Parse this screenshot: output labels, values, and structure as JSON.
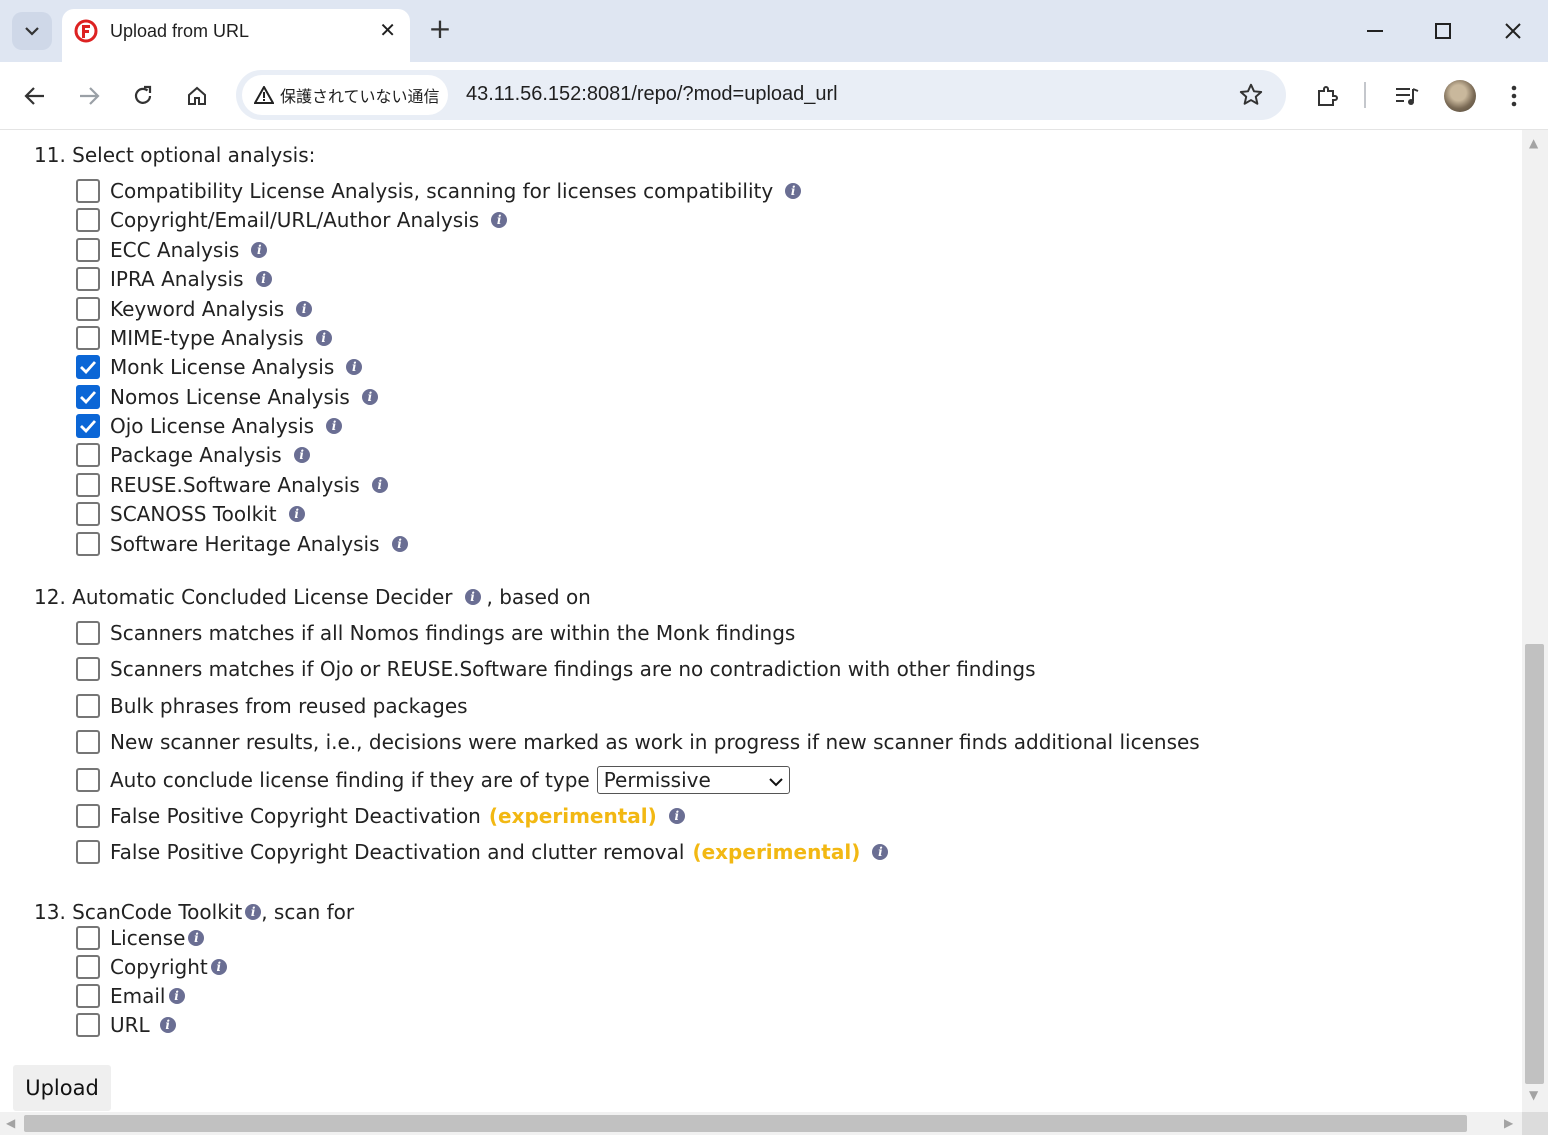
{
  "browser": {
    "tab_title": "Upload from URL",
    "security_label": "保護されていない通信",
    "url": "43.11.56.152:8081/repo/?mod=upload_url"
  },
  "section11": {
    "title": "11. Select optional analysis:",
    "options": [
      {
        "label": "Compatibility License Analysis, scanning for licenses compatibility",
        "checked": false
      },
      {
        "label": "Copyright/Email/URL/Author Analysis",
        "checked": false
      },
      {
        "label": "ECC Analysis",
        "checked": false
      },
      {
        "label": "IPRA Analysis",
        "checked": false
      },
      {
        "label": "Keyword Analysis",
        "checked": false
      },
      {
        "label": "MIME-type Analysis",
        "checked": false
      },
      {
        "label": "Monk License Analysis",
        "checked": true
      },
      {
        "label": "Nomos License Analysis",
        "checked": true
      },
      {
        "label": "Ojo License Analysis",
        "checked": true
      },
      {
        "label": "Package Analysis",
        "checked": false
      },
      {
        "label": "REUSE.Software Analysis",
        "checked": false
      },
      {
        "label": "SCANOSS Toolkit",
        "checked": false
      },
      {
        "label": "Software Heritage Analysis",
        "checked": false
      }
    ]
  },
  "section12": {
    "title": "12. Automatic Concluded License Decider",
    "title_suffix": ", based on",
    "options": [
      {
        "label": "Scanners matches if all Nomos findings are within the Monk findings",
        "checked": false
      },
      {
        "label": "Scanners matches if Ojo or REUSE.Software findings are no contradiction with other findings",
        "checked": false
      },
      {
        "label": "Bulk phrases from reused packages",
        "checked": false
      },
      {
        "label": "New scanner results, i.e., decisions were marked as work in progress if new scanner finds additional licenses",
        "checked": false
      },
      {
        "label": "Auto conclude license finding if they are of type",
        "checked": false,
        "select_value": "Permissive"
      },
      {
        "label": "False Positive Copyright Deactivation",
        "checked": false,
        "tag": "(experimental)"
      },
      {
        "label": "False Positive Copyright Deactivation and clutter removal",
        "checked": false,
        "tag": "(experimental)"
      }
    ]
  },
  "section13": {
    "title": "13. ScanCode Toolkit",
    "title_suffix": ", scan for",
    "options": [
      {
        "label": "License",
        "checked": false
      },
      {
        "label": "Copyright",
        "checked": false
      },
      {
        "label": "Email",
        "checked": false
      },
      {
        "label": "URL",
        "checked": false
      }
    ]
  },
  "upload_button": "Upload",
  "colors": {
    "checkbox_checked": "#0b66d6",
    "experimental": "#f2b813",
    "info_icon": "#6a6e93"
  }
}
